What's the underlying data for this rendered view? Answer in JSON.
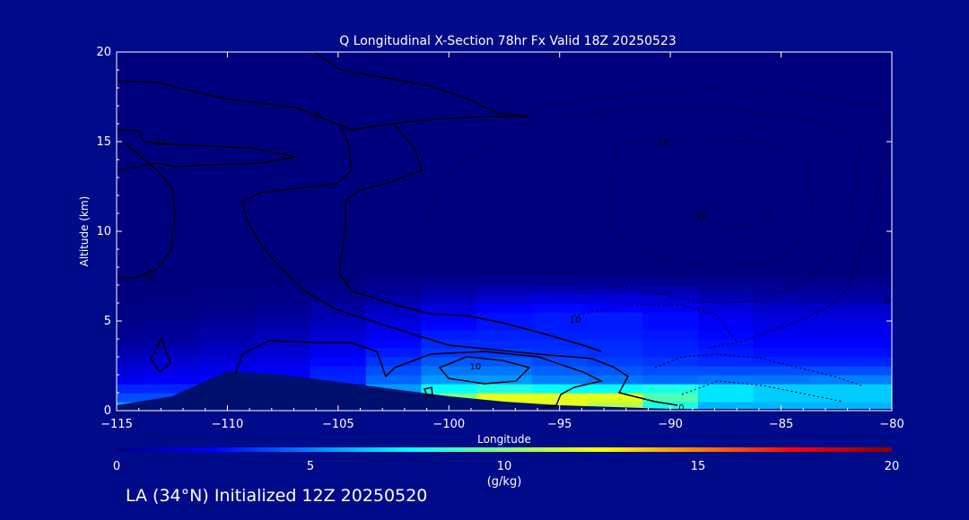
{
  "chart_data": {
    "type": "heatmap",
    "title": "Q Longitudinal X-Section 78hr  Fx Valid 18Z 20250523",
    "xlabel": "Longitude",
    "ylabel": "Altitude (km)",
    "xlim": [
      -115,
      -80
    ],
    "ylim": [
      0,
      20
    ],
    "x_ticks": [
      -115,
      -110,
      -105,
      -100,
      -95,
      -90,
      -85,
      -80
    ],
    "x_tick_labels": [
      "−115",
      "−110",
      "−105",
      "−100",
      "−95",
      "−90",
      "−85",
      "−80"
    ],
    "y_ticks": [
      0,
      5,
      10,
      15,
      20
    ],
    "y_tick_labels": [
      "0",
      "5",
      "10",
      "15",
      "20"
    ],
    "colorbar": {
      "label": "(g/kg)",
      "ticks": [
        0,
        5,
        10,
        15,
        20
      ],
      "tick_labels": [
        "0",
        "5",
        "10",
        "15",
        "20"
      ],
      "range": [
        0,
        20
      ],
      "colors": [
        "#00007f",
        "#0000ff",
        "#0080ff",
        "#00ffff",
        "#80ff80",
        "#ffff00",
        "#ff8000",
        "#ff0000",
        "#7f0000"
      ]
    },
    "field_x": [
      -115,
      -112.5,
      -110,
      -107.5,
      -105,
      -102.5,
      -100,
      -97.5,
      -95,
      -92.5,
      -90,
      -87.5,
      -85,
      -82.5,
      -80
    ],
    "field_y": [
      0.25,
      0.75,
      1.25,
      1.75,
      2.25,
      2.75,
      3.25,
      3.75,
      4.25,
      4.75,
      5.25,
      5.75,
      6.25,
      6.75,
      7.25,
      7.75
    ],
    "field_q": [
      [
        5.5,
        5.5,
        0,
        0,
        0,
        0,
        9,
        12,
        12,
        11,
        8,
        6,
        6,
        6,
        6
      ],
      [
        4,
        4,
        2,
        0,
        0,
        0,
        10,
        12,
        12,
        12,
        9,
        7,
        6.5,
        6.5,
        6.5
      ],
      [
        3.2,
        3.2,
        3.2,
        2.5,
        2.5,
        5.5,
        7.5,
        8,
        7.5,
        7.5,
        8,
        7,
        6.5,
        6.5,
        6.5
      ],
      [
        2.2,
        2.4,
        2.6,
        2.6,
        3.2,
        4.5,
        5.5,
        5.5,
        5,
        4.8,
        4.6,
        4.8,
        4.8,
        5,
        5
      ],
      [
        1.8,
        2,
        2.2,
        2.4,
        3,
        4,
        4.8,
        4.8,
        4.4,
        4.2,
        4,
        4,
        4,
        4,
        4
      ],
      [
        1.4,
        1.6,
        1.8,
        2,
        2.6,
        3.5,
        4.2,
        4.2,
        3.9,
        3.7,
        3.5,
        3.3,
        3.2,
        3.2,
        3.2
      ],
      [
        1,
        1.2,
        1.4,
        1.7,
        2.2,
        3,
        3.6,
        3.6,
        3.5,
        3.4,
        3.2,
        3,
        2.8,
        2.8,
        2.8
      ],
      [
        0.6,
        0.8,
        1.1,
        1.4,
        1.9,
        2.6,
        3.3,
        3.3,
        3.3,
        3.3,
        3.1,
        2.8,
        2.5,
        2.5,
        2.5
      ],
      [
        0.4,
        0.5,
        0.8,
        1.1,
        1.6,
        2.3,
        3,
        3.1,
        3.1,
        3.1,
        2.9,
        2.6,
        2.2,
        2.2,
        2.2
      ],
      [
        0.3,
        0.4,
        0.6,
        0.8,
        1.3,
        2,
        2.6,
        2.9,
        3,
        3,
        2.7,
        2.4,
        2,
        2,
        2
      ],
      [
        0.2,
        0.2,
        0.4,
        0.6,
        1,
        1.6,
        2.3,
        2.8,
        3,
        3,
        2.7,
        2.2,
        1.8,
        1.8,
        1.8
      ],
      [
        0.1,
        0.1,
        0.2,
        0.4,
        0.7,
        1.2,
        1.8,
        2.4,
        2.6,
        2.5,
        2.2,
        1.8,
        1.4,
        1.4,
        1.4
      ],
      [
        0,
        0.1,
        0.1,
        0.2,
        0.4,
        0.8,
        1.2,
        1.6,
        1.8,
        1.8,
        1.6,
        1.2,
        0.9,
        0.9,
        0.9
      ],
      [
        0,
        0,
        0.1,
        0.1,
        0.2,
        0.4,
        0.7,
        1,
        1.1,
        1.1,
        0.9,
        0.7,
        0.5,
        0.5,
        0.5
      ],
      [
        0,
        0,
        0,
        0,
        0.1,
        0.2,
        0.3,
        0.4,
        0.4,
        0.4,
        0.3,
        0.2,
        0.2,
        0.2,
        0.2
      ],
      [
        0,
        0,
        0,
        0,
        0,
        0,
        0,
        0,
        0,
        0,
        0,
        0,
        0,
        0,
        0
      ]
    ],
    "terrain_x": [
      -115,
      -112.5,
      -110,
      -107.5,
      -105,
      -102.5,
      -100,
      -97.5,
      -95,
      -92.5,
      -90,
      -87.5,
      -85,
      -82.5,
      -80
    ],
    "terrain_alt": [
      0.3,
      0.8,
      2.2,
      2.0,
      1.6,
      1.2,
      0.8,
      0.5,
      0.3,
      0.2,
      0.1,
      0.1,
      0.1,
      0.1,
      0.1
    ],
    "contour_labels": [
      {
        "text": "10",
        "lon": -113.0,
        "alt": 15.0
      },
      {
        "text": "0",
        "lon": -105.9,
        "alt": 16.5
      },
      {
        "text": "10",
        "lon": -113.5,
        "alt": 7.5
      },
      {
        "text": "0",
        "lon": -104.6,
        "alt": 7.2
      },
      {
        "text": "10",
        "lon": -98.8,
        "alt": 2.5
      },
      {
        "text": "0",
        "lon": -89.5,
        "alt": 0.2
      },
      {
        "text": "10",
        "lon": -88.6,
        "alt": 10.9
      },
      {
        "text": "10",
        "lon": -90.3,
        "alt": 15.0
      },
      {
        "text": "10",
        "lon": -94.3,
        "alt": 5.1
      },
      {
        "text": "0",
        "lon": -80.2,
        "alt": 6.2
      }
    ]
  },
  "footer": {
    "caption": "LA (34°N) Initialized 12Z 20250520"
  }
}
